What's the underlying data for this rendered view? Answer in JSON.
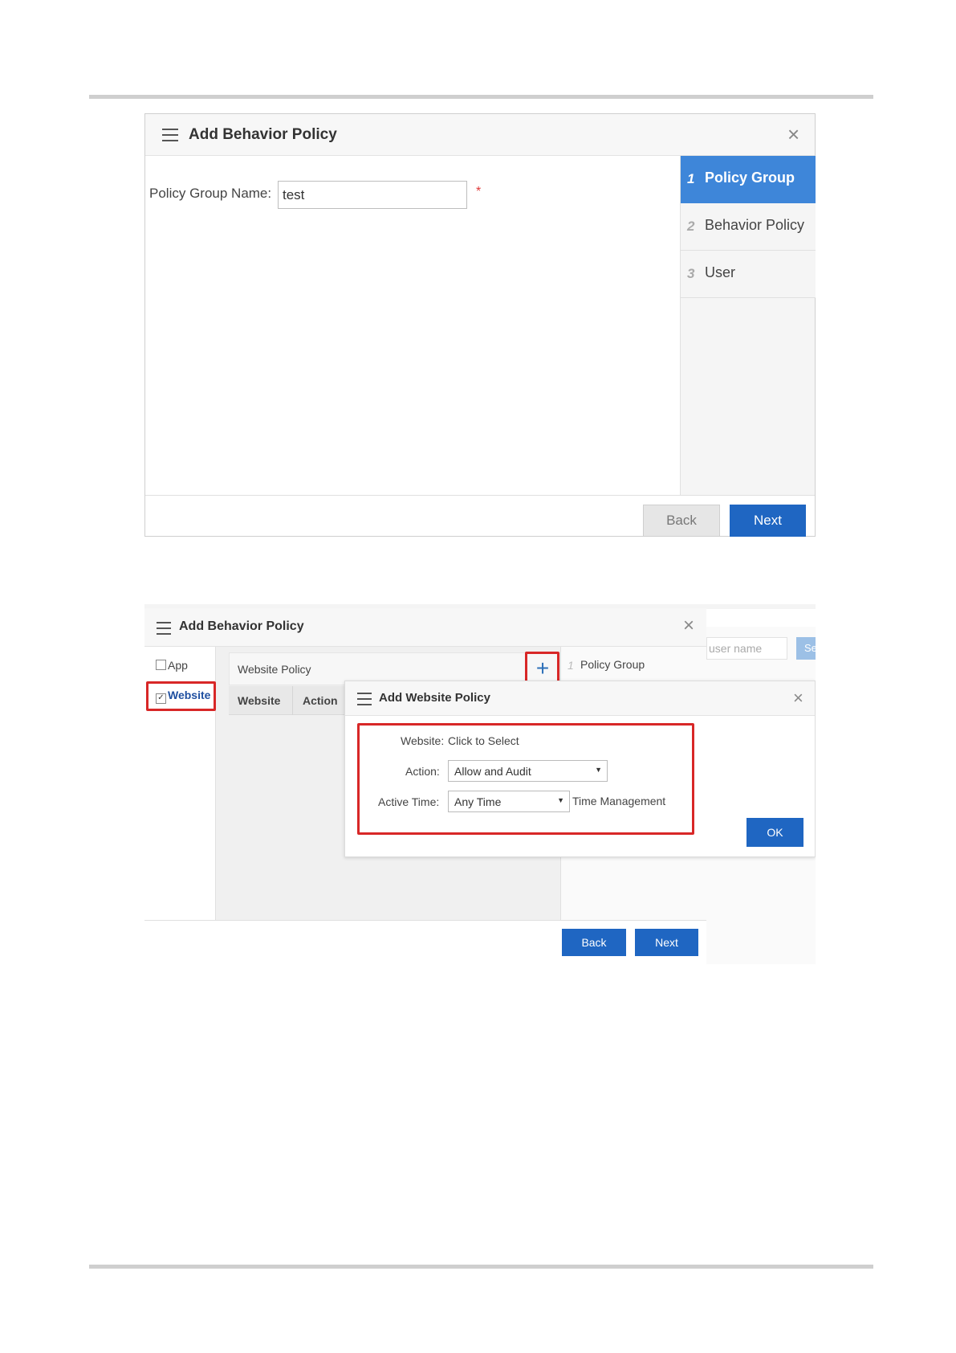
{
  "screen1": {
    "title": "Add Behavior Policy",
    "close_glyph": "×",
    "field_label": "Policy Group Name:",
    "field_value": "test",
    "required_mark": "*",
    "steps": [
      {
        "num": "1",
        "label": "Policy Group"
      },
      {
        "num": "2",
        "label": "Behavior Policy"
      },
      {
        "num": "3",
        "label": "User"
      }
    ],
    "back_label": "Back",
    "next_label": "Next"
  },
  "screen2": {
    "title": "Add Behavior Policy",
    "close_glyph": "×",
    "types": [
      {
        "label": "App",
        "checked": false
      },
      {
        "label": "Website",
        "checked": true
      }
    ],
    "panel_title": "Website Policy",
    "add_glyph": "+",
    "columns": [
      "Website",
      "Action"
    ],
    "step_label": "Policy Group",
    "step_num": "1",
    "search_placeholder": "user name",
    "search_button": "Se",
    "back_label": "Back",
    "next_label": "Next",
    "inner": {
      "title": "Add Website Policy",
      "close_glyph": "×",
      "website_label": "Website:",
      "website_link": "Click to Select",
      "action_label": "Action:",
      "action_value": "Allow and Audit",
      "active_time_label": "Active Time:",
      "active_time_value": "Any Time",
      "time_mgmt_link": "Time Management",
      "ok_label": "OK"
    }
  },
  "colors": {
    "primary_blue": "#1f66c2",
    "active_step": "#3e86d9",
    "highlight_red": "#d82727",
    "link": "#2c6fb8"
  }
}
